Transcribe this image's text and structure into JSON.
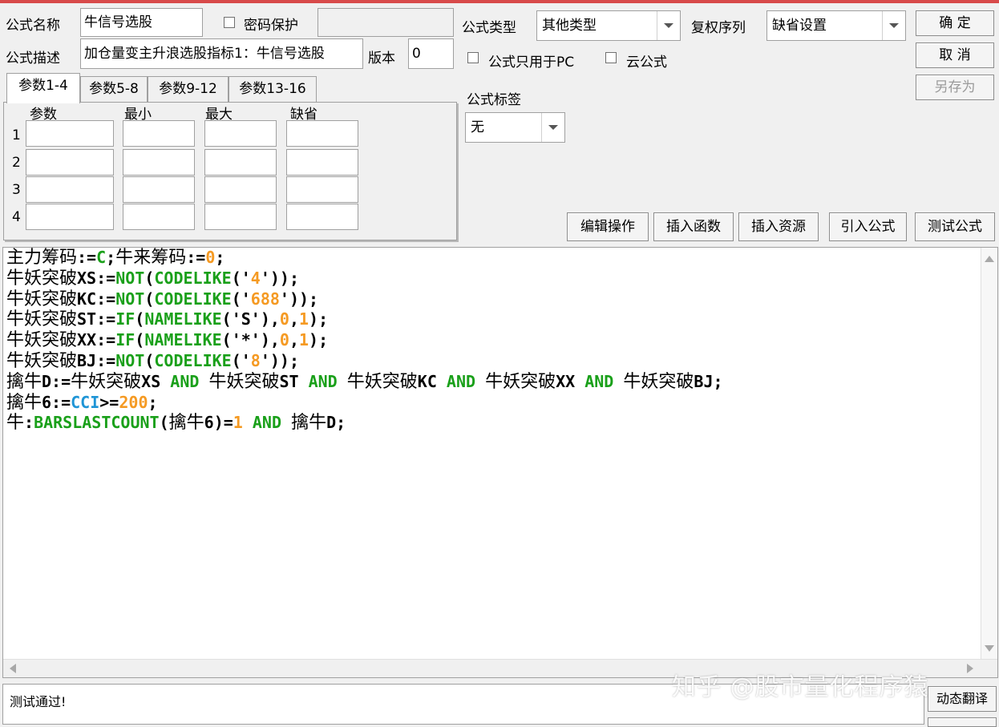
{
  "header": {
    "formula_name_label": "公式名称",
    "formula_name_value": "牛信号选股",
    "password_label": "密码保护",
    "password_checked": false,
    "password_value": "",
    "formula_desc_label": "公式描述",
    "formula_desc_value": "加仓量变主升浪选股指标1：牛信号选股",
    "version_label": "版本",
    "version_value": "0",
    "formula_type_label": "公式类型",
    "formula_type_value": "其他类型",
    "rights_label": "复权序列",
    "rights_value": "缺省设置",
    "pc_only_label": "公式只用于PC",
    "pc_only_checked": false,
    "cloud_label": "云公式",
    "cloud_checked": false,
    "tag_label": "公式标签",
    "tag_value": "无"
  },
  "buttons": {
    "ok": "确  定",
    "cancel": "取  消",
    "save_as": "另存为",
    "edit_ops": "编辑操作",
    "insert_func": "插入函数",
    "insert_res": "插入资源",
    "import_formula": "引入公式",
    "test_formula": "测试公式",
    "dynamic_translate": "动态翻译"
  },
  "tabs": [
    {
      "label": "参数1-4",
      "active": true
    },
    {
      "label": "参数5-8",
      "active": false
    },
    {
      "label": "参数9-12",
      "active": false
    },
    {
      "label": "参数13-16",
      "active": false
    }
  ],
  "params": {
    "headers": [
      "参数",
      "最小",
      "最大",
      "缺省"
    ],
    "rows": [
      "1",
      "2",
      "3",
      "4"
    ]
  },
  "code_lines": [
    [
      {
        "t": "主力筹码",
        "c": "cn"
      },
      {
        "t": ":="
      },
      {
        "t": "C",
        "s": "g"
      },
      {
        "t": ";"
      },
      {
        "t": "牛来筹码",
        "c": "cn"
      },
      {
        "t": ":="
      },
      {
        "t": "0",
        "s": "o"
      },
      {
        "t": ";"
      }
    ],
    [
      {
        "t": "牛妖突破",
        "c": "cn"
      },
      {
        "t": "XS:="
      },
      {
        "t": "NOT",
        "s": "g"
      },
      {
        "t": "("
      },
      {
        "t": "CODELIKE",
        "s": "g"
      },
      {
        "t": "('"
      },
      {
        "t": "4",
        "s": "o"
      },
      {
        "t": "'));"
      }
    ],
    [
      {
        "t": "牛妖突破",
        "c": "cn"
      },
      {
        "t": "KC:="
      },
      {
        "t": "NOT",
        "s": "g"
      },
      {
        "t": "("
      },
      {
        "t": "CODELIKE",
        "s": "g"
      },
      {
        "t": "('"
      },
      {
        "t": "688",
        "s": "o"
      },
      {
        "t": "'));"
      }
    ],
    [
      {
        "t": "牛妖突破",
        "c": "cn"
      },
      {
        "t": "ST:="
      },
      {
        "t": "IF",
        "s": "g"
      },
      {
        "t": "("
      },
      {
        "t": "NAMELIKE",
        "s": "g"
      },
      {
        "t": "('S'),"
      },
      {
        "t": "0",
        "s": "o"
      },
      {
        "t": ","
      },
      {
        "t": "1",
        "s": "o"
      },
      {
        "t": ");"
      }
    ],
    [
      {
        "t": "牛妖突破",
        "c": "cn"
      },
      {
        "t": "XX:="
      },
      {
        "t": "IF",
        "s": "g"
      },
      {
        "t": "("
      },
      {
        "t": "NAMELIKE",
        "s": "g"
      },
      {
        "t": "('*'),"
      },
      {
        "t": "0",
        "s": "o"
      },
      {
        "t": ","
      },
      {
        "t": "1",
        "s": "o"
      },
      {
        "t": ");"
      }
    ],
    [
      {
        "t": "牛妖突破",
        "c": "cn"
      },
      {
        "t": "BJ:="
      },
      {
        "t": "NOT",
        "s": "g"
      },
      {
        "t": "("
      },
      {
        "t": "CODELIKE",
        "s": "g"
      },
      {
        "t": "('"
      },
      {
        "t": "8",
        "s": "o"
      },
      {
        "t": "'));"
      }
    ],
    [
      {
        "t": "擒牛",
        "c": "cn"
      },
      {
        "t": "D:="
      },
      {
        "t": "牛妖突破",
        "c": "cn"
      },
      {
        "t": "XS "
      },
      {
        "t": "AND",
        "s": "g"
      },
      {
        "t": " "
      },
      {
        "t": "牛妖突破",
        "c": "cn"
      },
      {
        "t": "ST "
      },
      {
        "t": "AND",
        "s": "g"
      },
      {
        "t": " "
      },
      {
        "t": "牛妖突破",
        "c": "cn"
      },
      {
        "t": "KC "
      },
      {
        "t": "AND",
        "s": "g"
      },
      {
        "t": " "
      },
      {
        "t": "牛妖突破",
        "c": "cn"
      },
      {
        "t": "XX "
      },
      {
        "t": "AND",
        "s": "g"
      },
      {
        "t": " "
      },
      {
        "t": "牛妖突破",
        "c": "cn"
      },
      {
        "t": "BJ;"
      }
    ],
    [
      {
        "t": "擒牛",
        "c": "cn"
      },
      {
        "t": "6:="
      },
      {
        "t": "CCI",
        "s": "b"
      },
      {
        "t": ">="
      },
      {
        "t": "200",
        "s": "o"
      },
      {
        "t": ";"
      }
    ],
    [
      {
        "t": "牛",
        "c": "cn"
      },
      {
        "t": ":"
      },
      {
        "t": "BARSLASTCOUNT",
        "s": "g"
      },
      {
        "t": "("
      },
      {
        "t": "擒牛",
        "c": "cn"
      },
      {
        "t": "6)="
      },
      {
        "t": "1",
        "s": "o"
      },
      {
        "t": " "
      },
      {
        "t": "AND",
        "s": "g"
      },
      {
        "t": " "
      },
      {
        "t": "擒牛",
        "c": "cn"
      },
      {
        "t": "D;"
      }
    ]
  ],
  "status_text": "测试通过!",
  "watermark": "知乎 @股市量化程序猿",
  "colors": {
    "keyword": "#1aa01a",
    "number": "#f59a23",
    "function_blue": "#1f95d6",
    "accent_bar": "#d84a4a"
  }
}
